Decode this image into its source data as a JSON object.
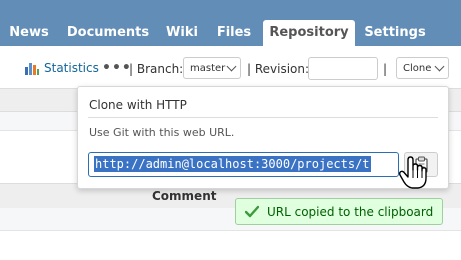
{
  "tabs": [
    {
      "label": "News",
      "selected": false
    },
    {
      "label": "Documents",
      "selected": false
    },
    {
      "label": "Wiki",
      "selected": false
    },
    {
      "label": "Files",
      "selected": false
    },
    {
      "label": "Repository",
      "selected": true
    },
    {
      "label": "Settings",
      "selected": false
    }
  ],
  "toolbar": {
    "statistics": "Statistics",
    "more": "•••",
    "branch_label": "| Branch:",
    "branch_value": "master",
    "revision_label": "| Revision:",
    "pipe": "|",
    "clone_value": "Clone"
  },
  "table": {
    "comment_header": "Comment"
  },
  "clone_popup": {
    "title": "Clone with HTTP",
    "hint": "Use Git with this web URL.",
    "url": "http://admin@localhost:3000/projects/t"
  },
  "flash": {
    "message": "URL copied to the clipboard"
  },
  "colors": {
    "tabbar": "#628db6",
    "link": "#116699",
    "selection": "#3b73c4",
    "flash_bg": "#dfffdf"
  }
}
